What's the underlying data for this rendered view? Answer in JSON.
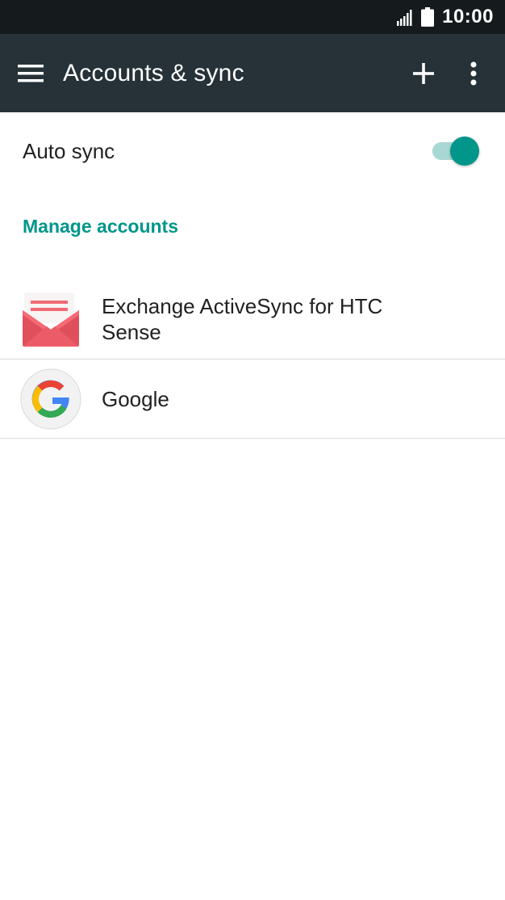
{
  "status_bar": {
    "time": "10:00",
    "icons": [
      "signal-icon",
      "battery-icon"
    ]
  },
  "app_bar": {
    "title": "Accounts & sync",
    "icons": [
      "menu-icon",
      "add-icon",
      "more-vert-icon"
    ]
  },
  "auto_sync": {
    "label": "Auto sync",
    "enabled": true
  },
  "manage_accounts": {
    "header": "Manage accounts",
    "items": [
      {
        "label": "Exchange ActiveSync for HTC Sense",
        "icon": "exchange-mail-icon"
      },
      {
        "label": "Google",
        "icon": "google-icon"
      }
    ]
  },
  "colors": {
    "status_bar": "#151a1d",
    "app_bar": "#263238",
    "accent": "#00968a",
    "switch_track": "#a7d8d4",
    "divider": "#dcdcdc"
  }
}
